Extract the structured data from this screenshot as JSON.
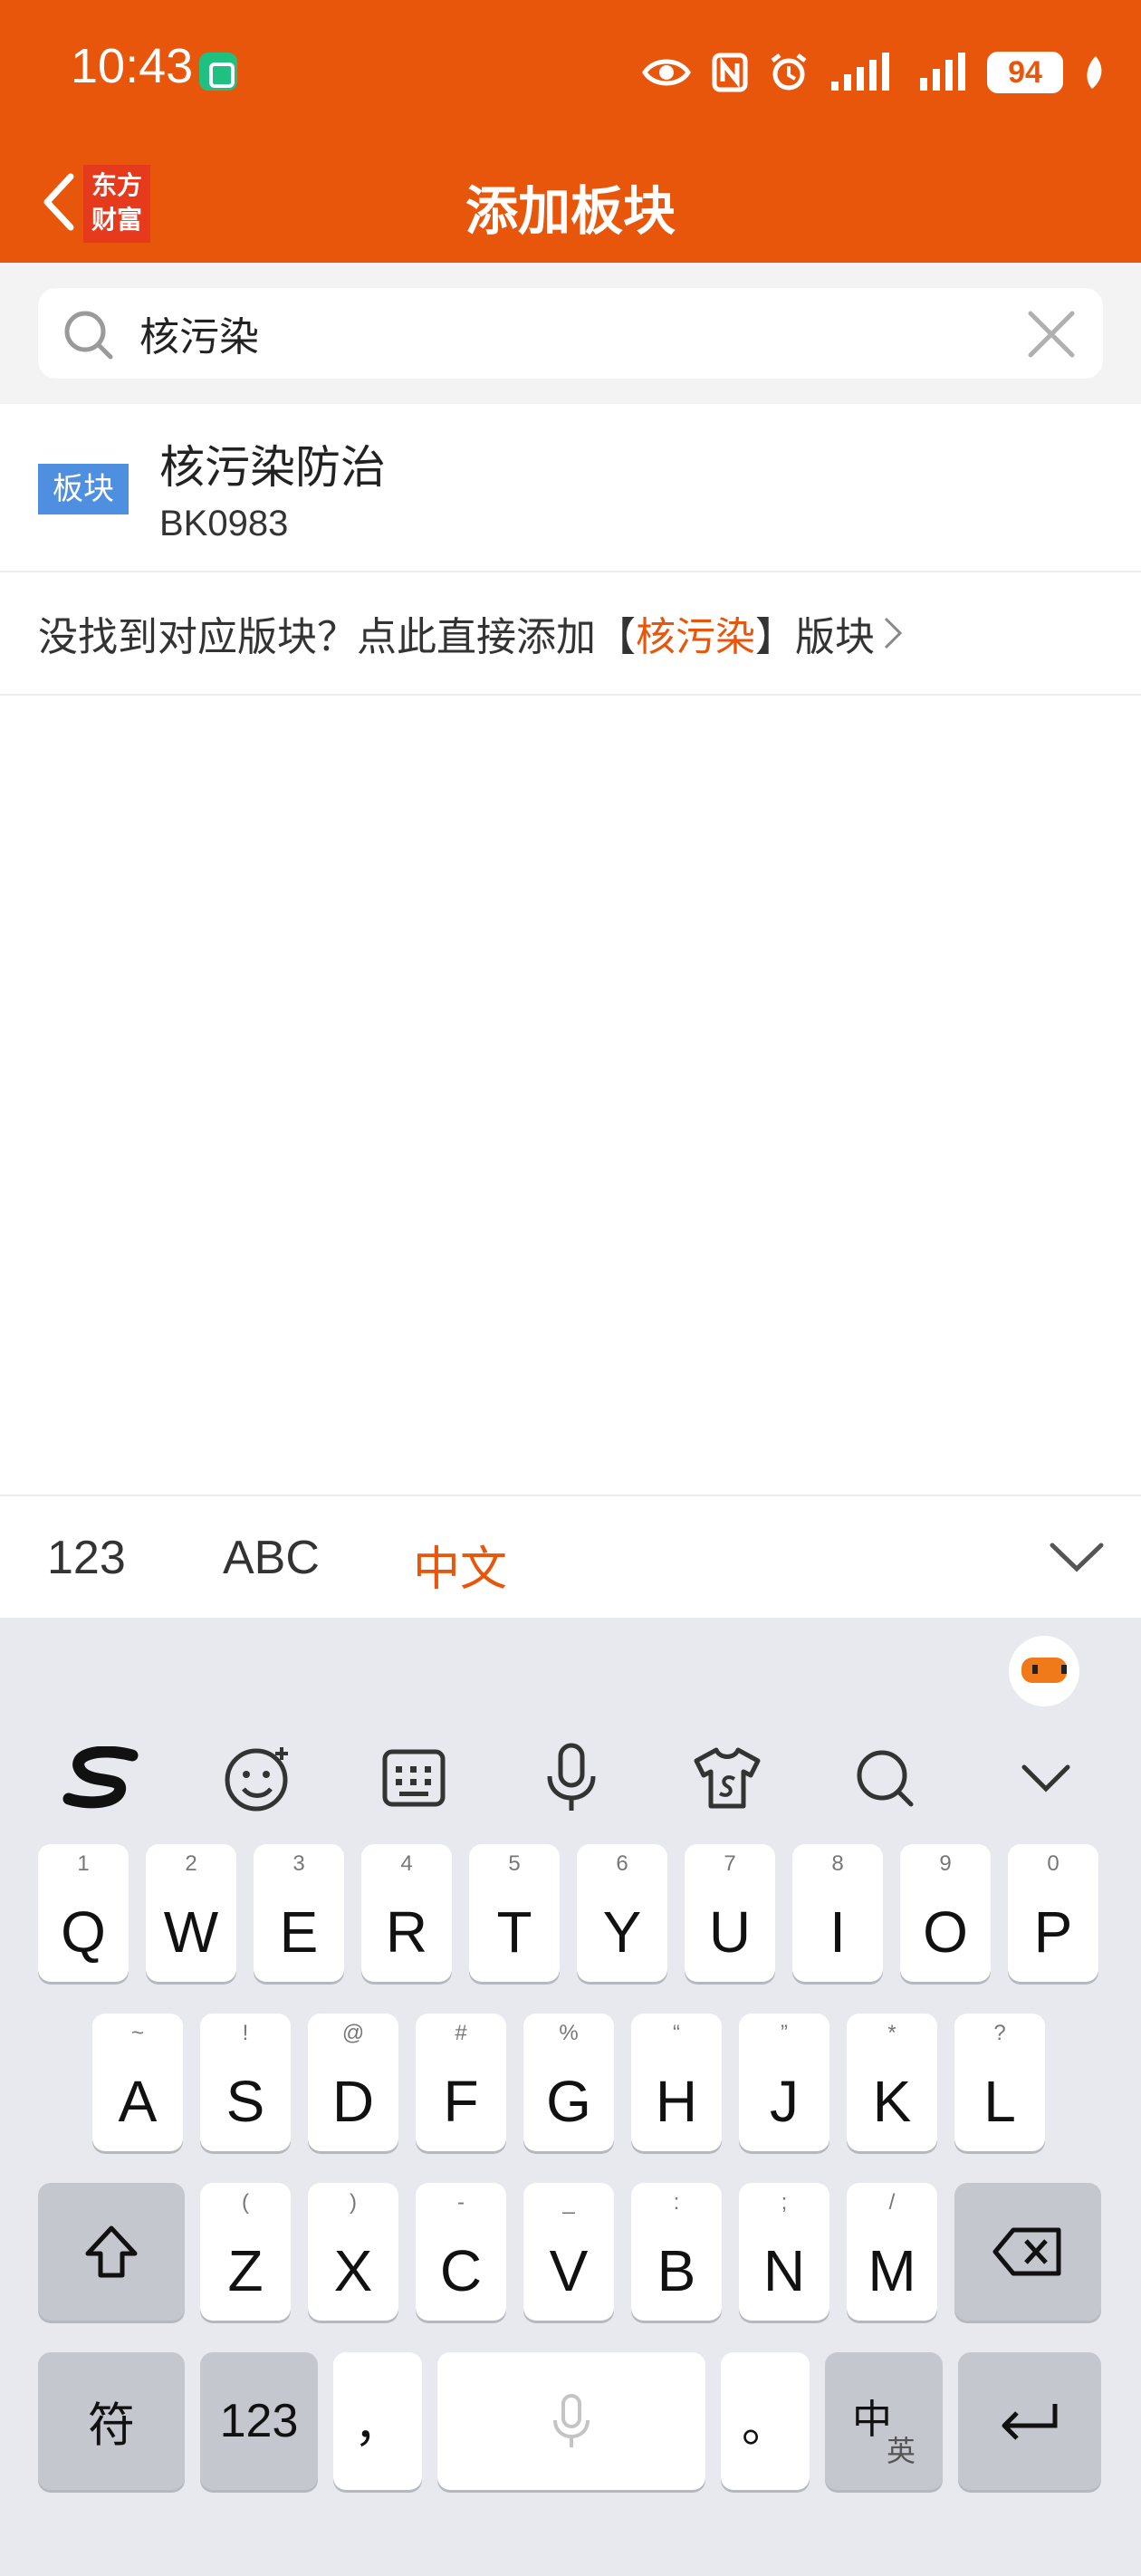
{
  "status_bar": {
    "time": "10:43",
    "battery": "94"
  },
  "header": {
    "title": "添加板块",
    "brand_line1": "东方",
    "brand_line2": "财富"
  },
  "search": {
    "value": "核污染",
    "placeholder": ""
  },
  "results": [
    {
      "tag": "板块",
      "name": "核污染防治",
      "code": "BK0983"
    }
  ],
  "hint": {
    "prefix": "没找到对应版块？点此直接添加【",
    "keyword": "核污染",
    "suffix": "】版块"
  },
  "ime_tabs": {
    "numeric": "123",
    "english": "ABC",
    "chinese": "中文",
    "active": "中文"
  },
  "keyboard": {
    "row1": [
      {
        "key": "Q",
        "sub": "1"
      },
      {
        "key": "W",
        "sub": "2"
      },
      {
        "key": "E",
        "sub": "3"
      },
      {
        "key": "R",
        "sub": "4"
      },
      {
        "key": "T",
        "sub": "5"
      },
      {
        "key": "Y",
        "sub": "6"
      },
      {
        "key": "U",
        "sub": "7"
      },
      {
        "key": "I",
        "sub": "8"
      },
      {
        "key": "O",
        "sub": "9"
      },
      {
        "key": "P",
        "sub": "0"
      }
    ],
    "row2": [
      {
        "key": "A",
        "sub": "~"
      },
      {
        "key": "S",
        "sub": "!"
      },
      {
        "key": "D",
        "sub": "@"
      },
      {
        "key": "F",
        "sub": "#"
      },
      {
        "key": "G",
        "sub": "%"
      },
      {
        "key": "H",
        "sub": "“"
      },
      {
        "key": "J",
        "sub": "”"
      },
      {
        "key": "K",
        "sub": "*"
      },
      {
        "key": "L",
        "sub": "?"
      }
    ],
    "row3": [
      {
        "key": "Z",
        "sub": "("
      },
      {
        "key": "X",
        "sub": ")"
      },
      {
        "key": "C",
        "sub": "-"
      },
      {
        "key": "V",
        "sub": "_"
      },
      {
        "key": "B",
        "sub": ":"
      },
      {
        "key": "N",
        "sub": ";"
      },
      {
        "key": "M",
        "sub": "/"
      }
    ],
    "symbols_key": "符",
    "numbers_key": "123",
    "comma_key": "，",
    "period_key": "。",
    "lang_key_main": "中",
    "lang_key_sub": "英"
  },
  "colors": {
    "accent": "#e8560b",
    "tag_blue": "#4f8fe0",
    "keyboard_bg": "#e8e9ee"
  },
  "icons": [
    "back-arrow-icon",
    "search-icon",
    "clear-icon",
    "chevron-right-icon",
    "chevron-down-icon",
    "sogou-logo-icon",
    "emoji-icon",
    "keyboard-icon",
    "microphone-icon",
    "skin-icon",
    "search-icon",
    "shift-icon",
    "backspace-icon",
    "enter-icon"
  ]
}
